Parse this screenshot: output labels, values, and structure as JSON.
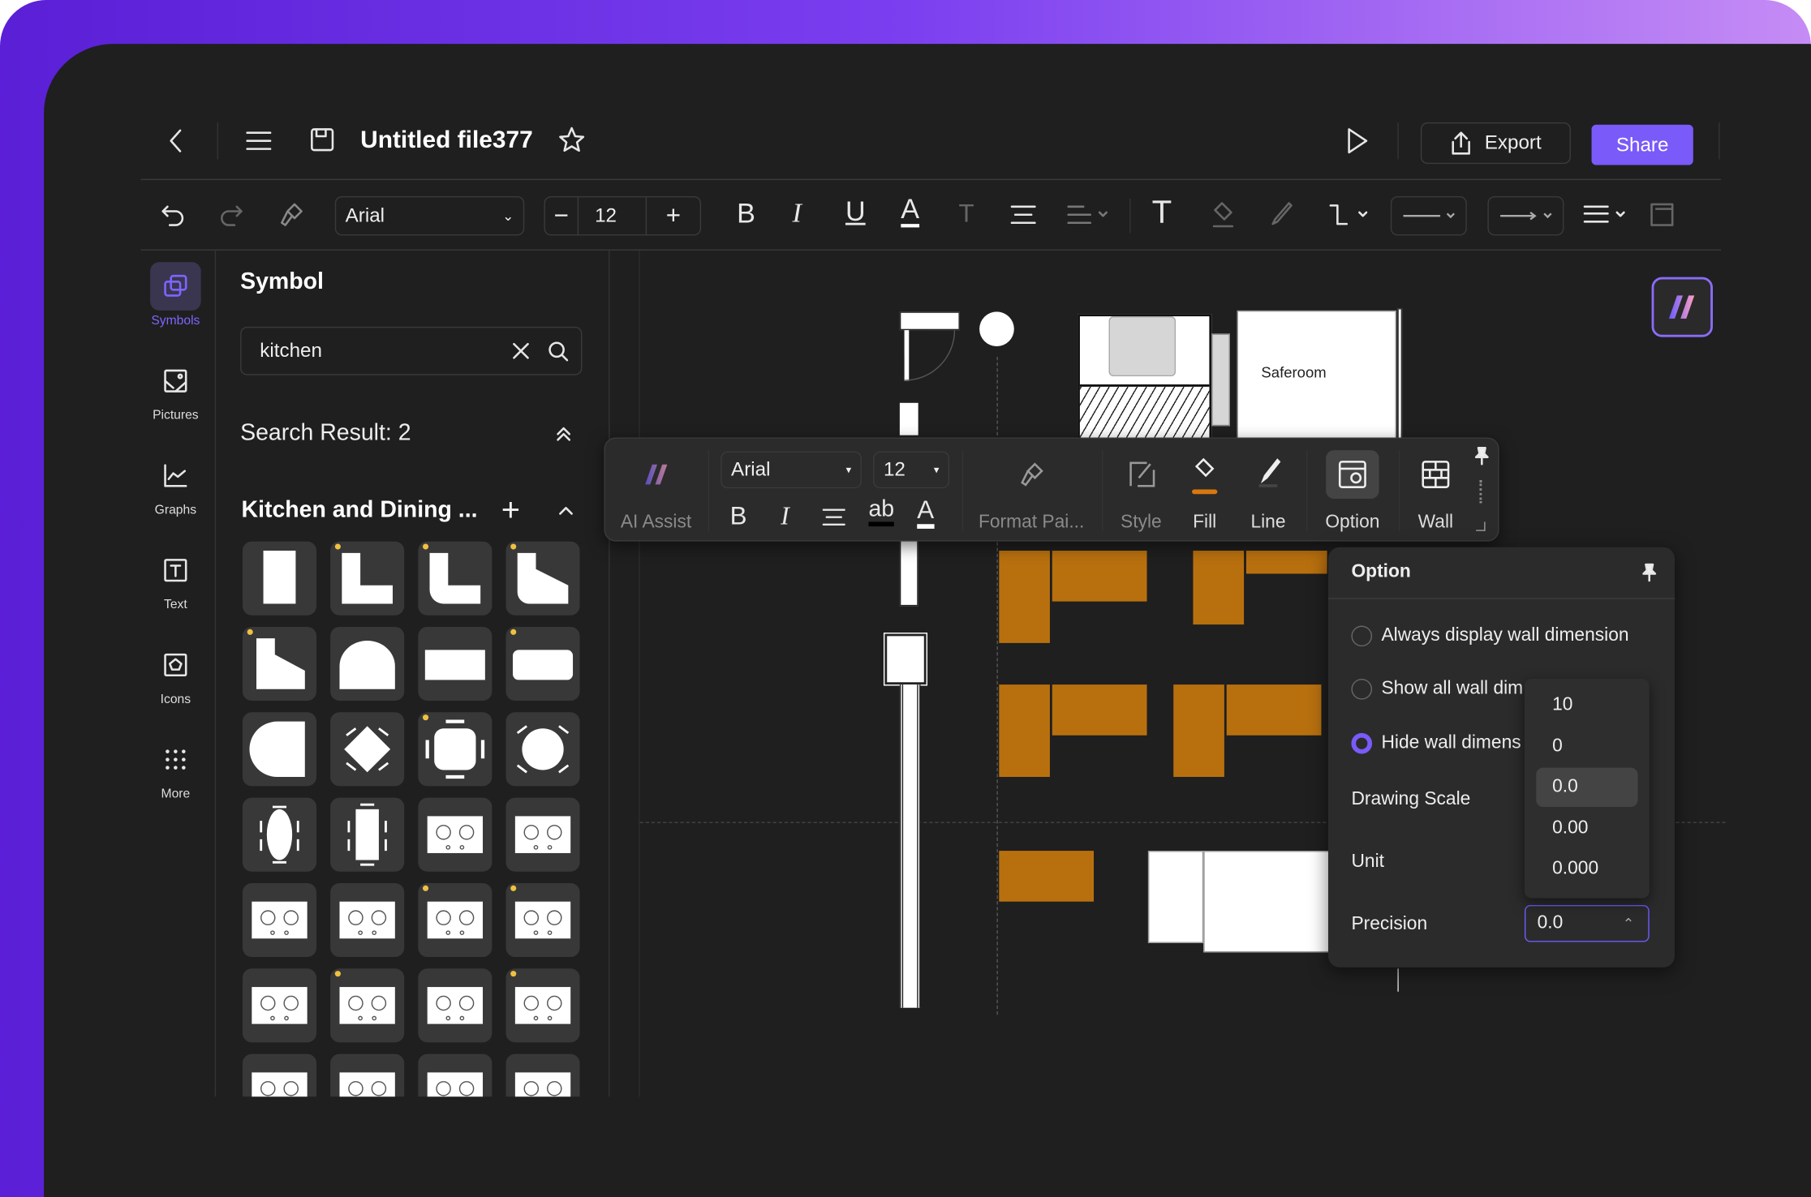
{
  "header": {
    "title": "Untitled file377",
    "export_label": "Export",
    "share_label": "Share"
  },
  "toolbar": {
    "font": "Arial",
    "font_size": "12"
  },
  "rail": {
    "items": [
      {
        "label": "Symbols",
        "icon": "symbols-icon",
        "active": true
      },
      {
        "label": "Pictures",
        "icon": "pictures-icon"
      },
      {
        "label": "Graphs",
        "icon": "graphs-icon"
      },
      {
        "label": "Text",
        "icon": "text-icon"
      },
      {
        "label": "Icons",
        "icon": "icons-icon"
      },
      {
        "label": "More",
        "icon": "more-icon"
      }
    ]
  },
  "panel": {
    "title": "Symbol",
    "search_value": "kitchen",
    "search_result": "Search Result: 2",
    "category": "Kitchen and Dining ...",
    "tiles": [
      {
        "icon": "counter-straight",
        "premium": false
      },
      {
        "icon": "counter-l",
        "premium": true
      },
      {
        "icon": "counter-l-rounded",
        "premium": true
      },
      {
        "icon": "counter-l-angled",
        "premium": true
      },
      {
        "icon": "counter-angled",
        "premium": true
      },
      {
        "icon": "counter-arched",
        "premium": false
      },
      {
        "icon": "counter-rect",
        "premium": false
      },
      {
        "icon": "counter-rounded-rect",
        "premium": true
      },
      {
        "icon": "counter-half-round",
        "premium": false
      },
      {
        "icon": "table-square-diagonal",
        "premium": false
      },
      {
        "icon": "table-square-4-chairs",
        "premium": true
      },
      {
        "icon": "table-round-4-chairs",
        "premium": false
      },
      {
        "icon": "table-oval-6-chairs",
        "premium": false
      },
      {
        "icon": "table-rect-6-chairs",
        "premium": false
      },
      {
        "icon": "cooktop-2-burner",
        "premium": false
      },
      {
        "icon": "range-2-burner",
        "premium": false
      },
      {
        "icon": "burner-single",
        "premium": false
      },
      {
        "icon": "cooktop-2-ring",
        "premium": false
      },
      {
        "icon": "cooktop-2-gas",
        "premium": true
      },
      {
        "icon": "cooktop-1-gas",
        "premium": true
      },
      {
        "icon": "cooktop-griddle",
        "premium": false
      },
      {
        "icon": "cooktop-4-gas",
        "premium": true
      },
      {
        "icon": "cooktop-6-gas",
        "premium": false
      },
      {
        "icon": "cooktop-4-gas-wide",
        "premium": true
      },
      {
        "icon": "cooktop-ring-small",
        "premium": false
      },
      {
        "icon": "counter-plain",
        "premium": false
      },
      {
        "icon": "range-ring",
        "premium": false
      },
      {
        "icon": "range-mixed",
        "premium": false
      }
    ]
  },
  "canvas": {
    "room_label": "Saferoom",
    "wall_color": "#ffffff",
    "furniture_color": "#b8700f"
  },
  "float_toolbar": {
    "ai_label": "AI Assist",
    "font": "Arial",
    "font_size": "12",
    "format_label": "Format Pai...",
    "style_label": "Style",
    "fill_label": "Fill",
    "line_label": "Line",
    "option_label": "Option",
    "wall_label": "Wall"
  },
  "option_panel": {
    "title": "Option",
    "radio_1": "Always display wall dimension",
    "radio_2": "Show all wall dim",
    "radio_3": "Hide wall dimens",
    "selected_radio": 3,
    "drawing_scale_label": "Drawing Scale",
    "unit_label": "Unit",
    "precision_label": "Precision",
    "precision_value": "0.0",
    "precision_options": [
      "10",
      "0",
      "0.0",
      "0.00",
      "0.000"
    ],
    "highlighted_option": "0.0"
  },
  "colors": {
    "accent": "#7a5af8",
    "background": "#1f1f1f"
  }
}
